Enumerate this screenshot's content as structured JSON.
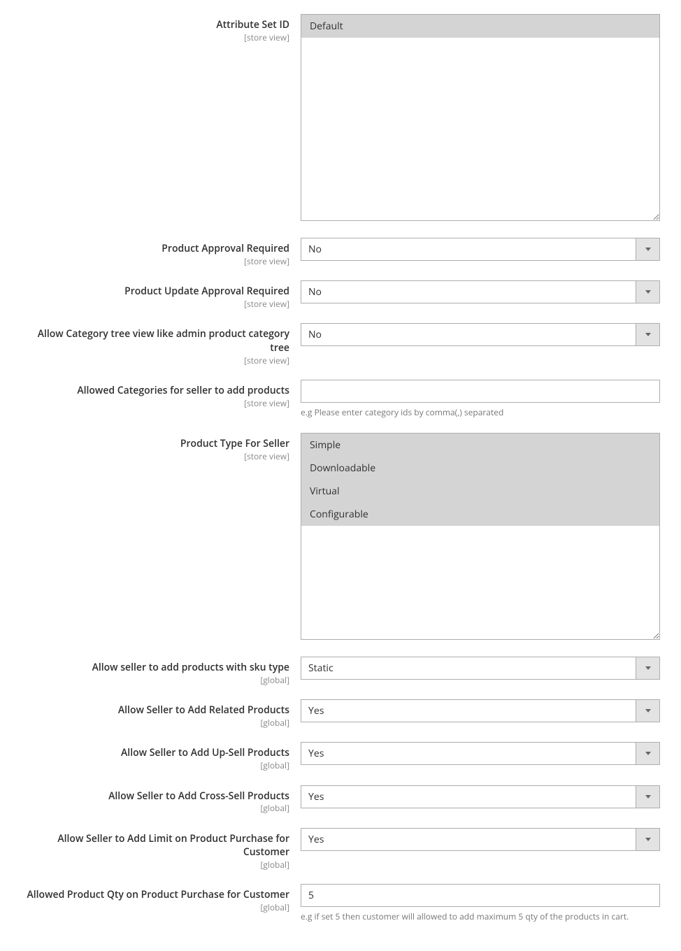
{
  "fields": {
    "attribute_set": {
      "label": "Attribute Set ID",
      "scope": "[store view]",
      "options": [
        {
          "label": "Default",
          "selected": true
        }
      ]
    },
    "product_approval": {
      "label": "Product Approval Required",
      "scope": "[store view]",
      "value": "No"
    },
    "product_update_approval": {
      "label": "Product Update Approval Required",
      "scope": "[store view]",
      "value": "No"
    },
    "category_tree": {
      "label": "Allow Category tree view like admin product category tree",
      "scope": "[store view]",
      "value": "No"
    },
    "allowed_categories": {
      "label": "Allowed Categories for seller to add products",
      "scope": "[store view]",
      "value": "",
      "help": "e.g Please enter category ids by comma(,) separated"
    },
    "product_type": {
      "label": "Product Type For Seller",
      "scope": "[store view]",
      "options": [
        {
          "label": "Simple",
          "selected": true
        },
        {
          "label": "Downloadable",
          "selected": true
        },
        {
          "label": "Virtual",
          "selected": true
        },
        {
          "label": "Configurable",
          "selected": true
        }
      ]
    },
    "sku_type": {
      "label": "Allow seller to add products with sku type",
      "scope": "[global]",
      "value": "Static"
    },
    "related": {
      "label": "Allow Seller to Add Related Products",
      "scope": "[global]",
      "value": "Yes"
    },
    "upsell": {
      "label": "Allow Seller to Add Up-Sell Products",
      "scope": "[global]",
      "value": "Yes"
    },
    "crosssell": {
      "label": "Allow Seller to Add Cross-Sell Products",
      "scope": "[global]",
      "value": "Yes"
    },
    "purchase_limit": {
      "label": "Allow Seller to Add Limit on Product Purchase for Customer",
      "scope": "[global]",
      "value": "Yes"
    },
    "allowed_qty": {
      "label": "Allowed Product Qty on Product Purchase for Customer",
      "scope": "[global]",
      "value": "5",
      "help": "e.g if set 5 then customer will allowed to add maximum 5 qty of the products in cart."
    }
  }
}
